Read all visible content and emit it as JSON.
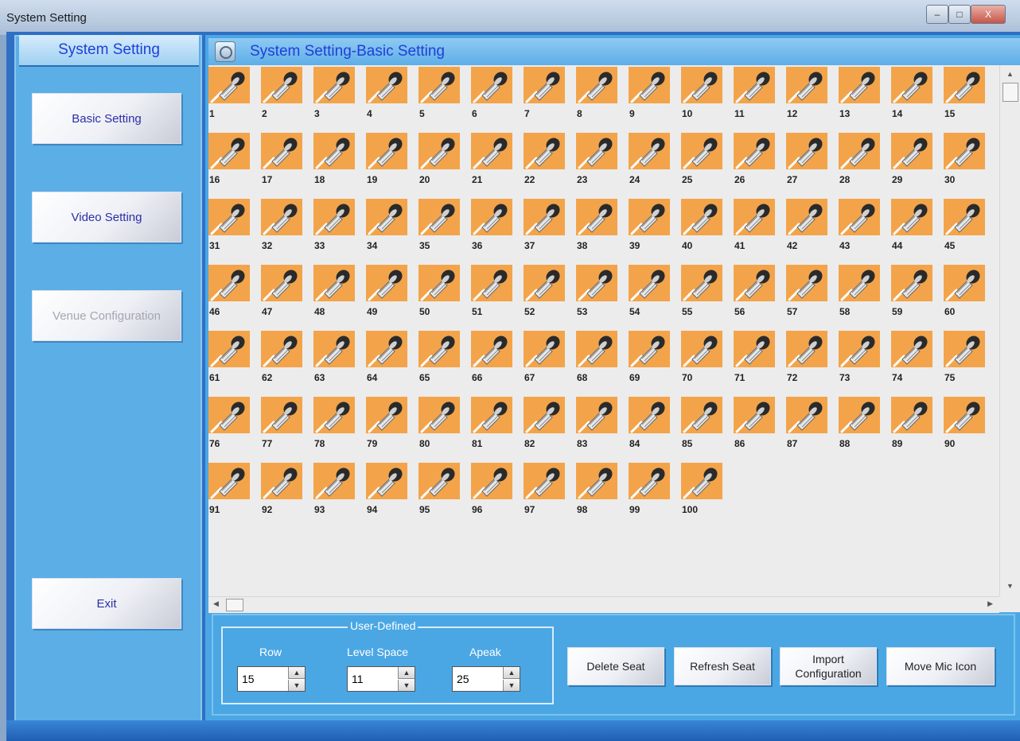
{
  "window": {
    "title": "System Setting",
    "min": "–",
    "max": "□",
    "close": "X"
  },
  "sidebar": {
    "header": "System Setting",
    "items": [
      {
        "label": "Basic Setting",
        "enabled": true
      },
      {
        "label": "Video Setting",
        "enabled": true
      },
      {
        "label": "Venue Configuration",
        "enabled": false
      }
    ],
    "exit": "Exit"
  },
  "main": {
    "header": "System Setting-Basic Setting",
    "seat_icon": "microphone-icon",
    "seat_color": "#f3a44a",
    "seats": [
      "1",
      "2",
      "3",
      "4",
      "5",
      "6",
      "7",
      "8",
      "9",
      "10",
      "11",
      "12",
      "13",
      "14",
      "15",
      "16",
      "17",
      "18",
      "19",
      "20",
      "21",
      "22",
      "23",
      "24",
      "25",
      "26",
      "27",
      "28",
      "29",
      "30",
      "31",
      "32",
      "33",
      "34",
      "35",
      "36",
      "37",
      "38",
      "39",
      "40",
      "41",
      "42",
      "43",
      "44",
      "45",
      "46",
      "47",
      "48",
      "49",
      "50",
      "51",
      "52",
      "53",
      "54",
      "55",
      "56",
      "57",
      "58",
      "59",
      "60",
      "61",
      "62",
      "63",
      "64",
      "65",
      "66",
      "67",
      "68",
      "69",
      "70",
      "71",
      "72",
      "73",
      "74",
      "75",
      "76",
      "77",
      "78",
      "79",
      "80",
      "81",
      "82",
      "83",
      "84",
      "85",
      "86",
      "87",
      "88",
      "89",
      "90",
      "91",
      "92",
      "93",
      "94",
      "95",
      "96",
      "97",
      "98",
      "99",
      "100"
    ]
  },
  "user_defined": {
    "title": "User-Defined",
    "row": {
      "label": "Row",
      "value": "15"
    },
    "level_space": {
      "label": "Level Space",
      "value": "11"
    },
    "apeak": {
      "label": "Apeak",
      "value": "25"
    }
  },
  "actions": {
    "delete_seat": "Delete Seat",
    "refresh_seat": "Refresh Seat",
    "import_line1": "Import",
    "import_line2": "Configuration",
    "move_mic_icon": "Move Mic Icon"
  }
}
